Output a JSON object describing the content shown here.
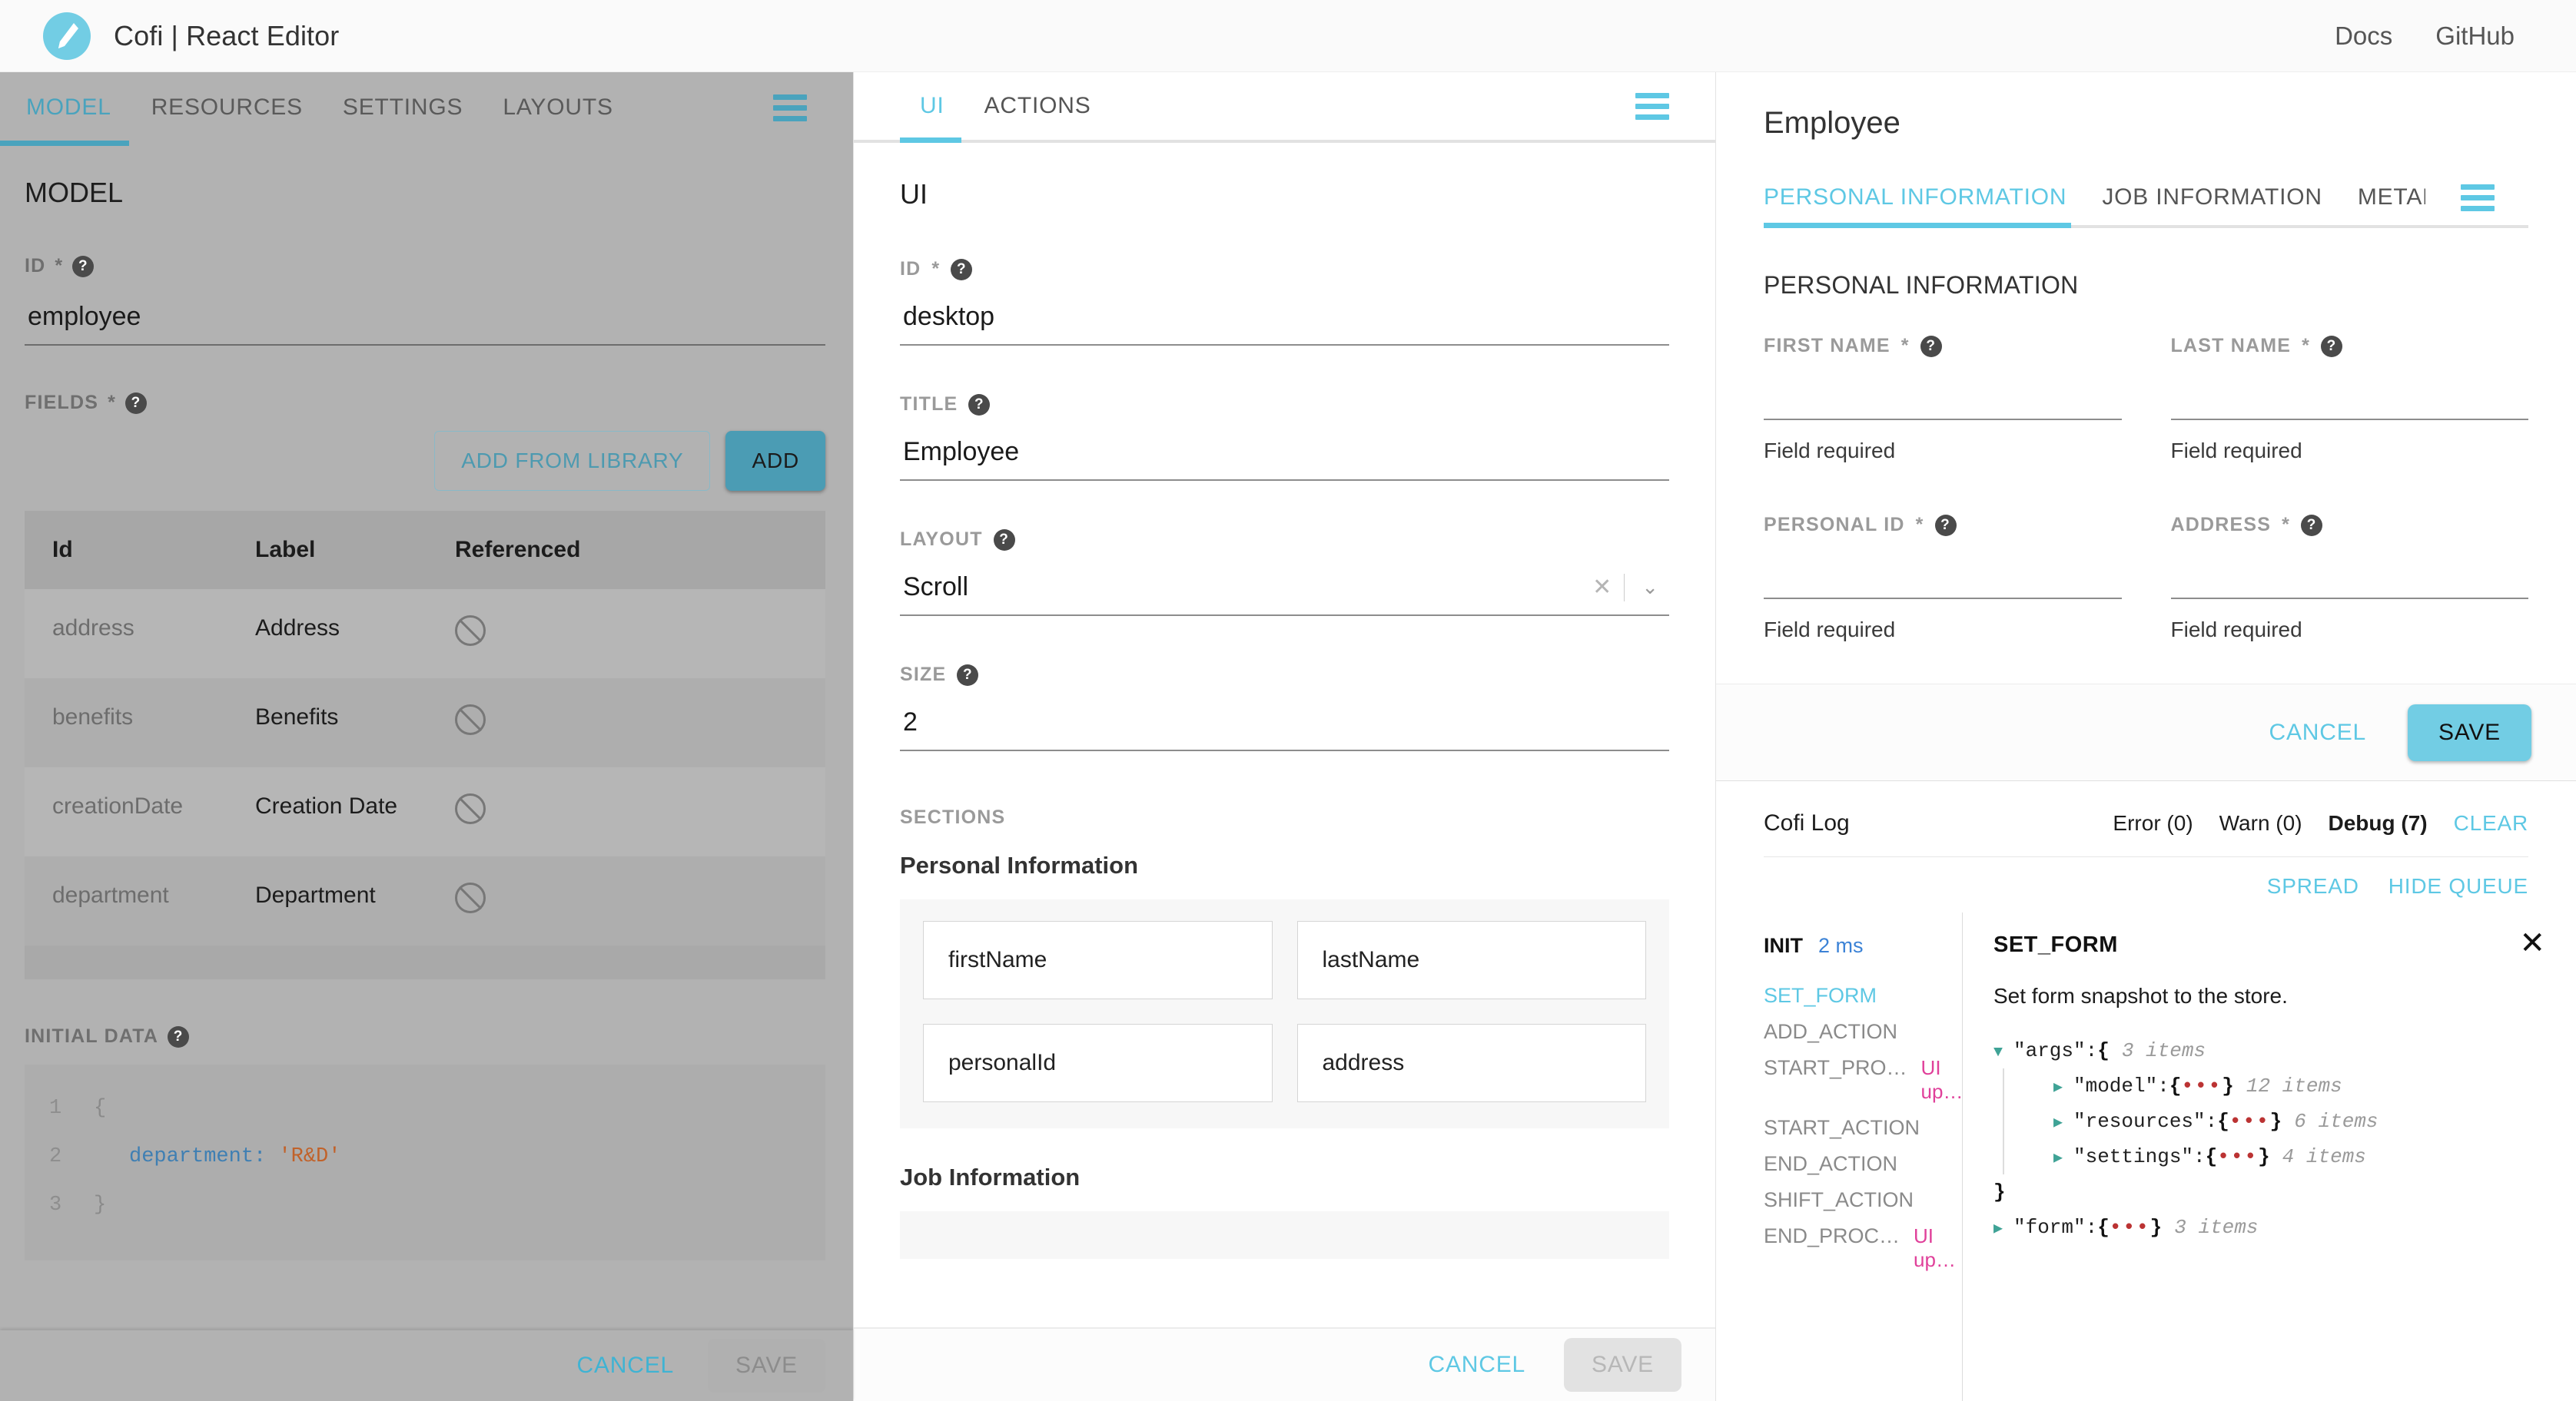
{
  "topbar": {
    "brand_title": "Cofi | React Editor",
    "logo_icon": "pencil-icon",
    "links": [
      {
        "label": "Docs"
      },
      {
        "label": "GitHub"
      }
    ]
  },
  "left_panel": {
    "tabs": [
      {
        "label": "MODEL",
        "active": true
      },
      {
        "label": "RESOURCES",
        "active": false
      },
      {
        "label": "SETTINGS",
        "active": false
      },
      {
        "label": "LAYOUTS",
        "active": false
      }
    ],
    "menu_icon": "hamburger-menu-icon",
    "title": "MODEL",
    "id_field": {
      "label": "ID",
      "required": "*",
      "help": "?",
      "value": "employee"
    },
    "fields_label": {
      "label": "FIELDS",
      "required": "*",
      "help": "?"
    },
    "add_from_library_button": "ADD FROM LIBRARY",
    "add_button": "ADD",
    "table": {
      "columns": [
        "Id",
        "Label",
        "Referenced"
      ],
      "rows": [
        {
          "id": "address",
          "label": "Address",
          "referenced": "not-referenced-icon"
        },
        {
          "id": "benefits",
          "label": "Benefits",
          "referenced": "not-referenced-icon"
        },
        {
          "id": "creationDate",
          "label": "Creation Date",
          "referenced": "not-referenced-icon"
        },
        {
          "id": "department",
          "label": "Department",
          "referenced": "not-referenced-icon"
        }
      ]
    },
    "initial_data_label": {
      "label": "INITIAL DATA",
      "help": "?"
    },
    "code": [
      {
        "n": "1",
        "key": "",
        "text": "{"
      },
      {
        "n": "2",
        "key": "department:",
        "text": "'R&D'"
      },
      {
        "n": "3",
        "key": "",
        "text": "}"
      }
    ],
    "cancel_button": "CANCEL",
    "save_button": "SAVE"
  },
  "mid_panel": {
    "tabs": [
      {
        "label": "UI",
        "active": true
      },
      {
        "label": "ACTIONS",
        "active": false
      }
    ],
    "menu_icon": "hamburger-menu-icon",
    "title": "UI",
    "id_field": {
      "label": "ID",
      "required": "*",
      "help": "?",
      "value": "desktop"
    },
    "title_field": {
      "label": "TITLE",
      "help": "?",
      "value": "Employee"
    },
    "layout_field": {
      "label": "LAYOUT",
      "help": "?",
      "value": "Scroll",
      "clear_icon": "x-clear-icon",
      "caret_icon": "chevron-down-icon"
    },
    "size_field": {
      "label": "SIZE",
      "help": "?",
      "value": "2"
    },
    "sections_label": "SECTIONS",
    "sections": [
      {
        "name": "Personal Information",
        "chips": [
          "firstName",
          "lastName",
          "personalId",
          "address"
        ]
      },
      {
        "name": "Job Information",
        "chips": []
      }
    ],
    "cancel_button": "CANCEL",
    "save_button": "SAVE"
  },
  "right_panel": {
    "title": "Employee",
    "tabs": [
      {
        "label": "PERSONAL INFORMATION",
        "active": true
      },
      {
        "label": "JOB INFORMATION",
        "active": false
      },
      {
        "label": "METADATA",
        "active": false
      }
    ],
    "menu_icon": "hamburger-menu-icon",
    "section_title": "PERSONAL INFORMATION",
    "fields": [
      {
        "label": "FIRST NAME",
        "required": "*",
        "help": "?",
        "value": "",
        "error": "Field required"
      },
      {
        "label": "LAST NAME",
        "required": "*",
        "help": "?",
        "value": "",
        "error": "Field required"
      },
      {
        "label": "PERSONAL ID",
        "required": "*",
        "help": "?",
        "value": "",
        "error": "Field required"
      },
      {
        "label": "ADDRESS",
        "required": "*",
        "help": "?",
        "value": "",
        "error": "Field required"
      }
    ],
    "cancel_button": "CANCEL",
    "save_button": "SAVE"
  },
  "cofi_log": {
    "name": "Cofi Log",
    "error_count": "Error (0)",
    "warn_count": "Warn (0)",
    "debug_count": "Debug (7)",
    "clear_button": "CLEAR",
    "spread_button": "SPREAD",
    "hide_queue_button": "HIDE QUEUE",
    "queue": {
      "init_label": "INIT",
      "init_time": "2 ms",
      "items": [
        {
          "label": "SET_FORM",
          "note": "",
          "selected": true
        },
        {
          "label": "ADD_ACTION",
          "note": "",
          "selected": false
        },
        {
          "label": "START_PRO…",
          "note": "UI up…",
          "selected": false
        },
        {
          "label": "START_ACTION",
          "note": "",
          "selected": false
        },
        {
          "label": "END_ACTION",
          "note": "",
          "selected": false
        },
        {
          "label": "SHIFT_ACTION",
          "note": "",
          "selected": false
        },
        {
          "label": "END_PROC…",
          "note": "UI up…",
          "selected": false
        }
      ]
    },
    "detail": {
      "title": "SET_FORM",
      "close_icon": "close-icon",
      "description": "Set form snapshot to the store.",
      "tree": [
        {
          "indent": 0,
          "caret": "open",
          "key": "\"args\"",
          "sep": " : ",
          "brace": "{",
          "dots": false,
          "count": "3 items"
        },
        {
          "indent": 1,
          "caret": "closed",
          "key": "\"model\"",
          "sep": " : ",
          "brace": "{",
          "dots": true,
          "count": "12 items"
        },
        {
          "indent": 1,
          "caret": "closed",
          "key": "\"resources\"",
          "sep": " : ",
          "brace": "{",
          "dots": true,
          "count": "6 items"
        },
        {
          "indent": 1,
          "caret": "closed",
          "key": "\"settings\"",
          "sep": " : ",
          "brace": "{",
          "dots": true,
          "count": "4 items"
        },
        {
          "indent": 0,
          "caret": "none",
          "key": "",
          "sep": "",
          "brace": "}",
          "dots": false,
          "count": ""
        },
        {
          "indent": 0,
          "caret": "closed",
          "key": "\"form\"",
          "sep": " : ",
          "brace": "{",
          "dots": true,
          "count": "3 items"
        }
      ]
    }
  },
  "colors": {
    "accent_cyan": "#5ec8e4",
    "accent_teal": "#4b9cb4",
    "save_cyan": "#72cde4",
    "panel_gray": "#b2b2b2",
    "log_pink": "#e0409a",
    "log_blue": "#3b82d6"
  }
}
